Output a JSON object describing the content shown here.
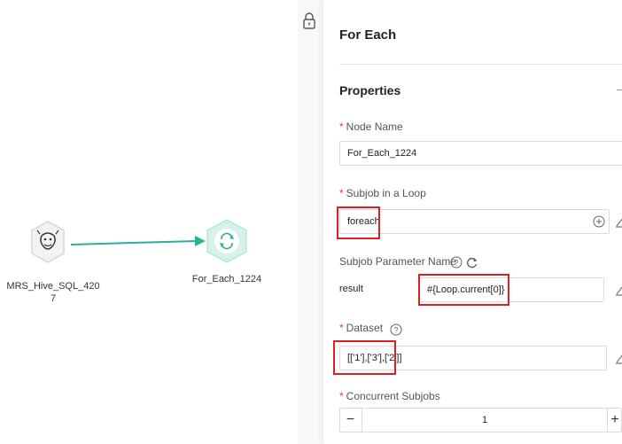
{
  "canvas": {
    "nodes": [
      {
        "name": "MRS_Hive_SQL_4207",
        "label_line1": "MRS_Hive_SQL_420",
        "label_line2": "7",
        "icon": "hive-icon"
      },
      {
        "name": "For_Each_1224",
        "label_line1": "For_Each_1224",
        "icon": "loop-icon"
      }
    ],
    "connector_color": "#2bb09a",
    "lock_icon": "lock-icon"
  },
  "panel": {
    "title": "For Each",
    "section_title": "Properties",
    "node_name": {
      "required": "*",
      "label": "Node Name",
      "value": "For_Each_1224"
    },
    "subjob": {
      "required": "*",
      "label": "Subjob in a Loop",
      "value": "foreach",
      "add_icon": "plus-circle-icon",
      "edit_icon": "edit-icon"
    },
    "subjob_param": {
      "label": "Subjob Parameter Name",
      "help_icon": "help-icon",
      "refresh_icon": "refresh-icon",
      "param_name": "result",
      "param_value": "#{Loop.current[0]}",
      "edit_icon": "edit-icon"
    },
    "dataset": {
      "required": "*",
      "label": "Dataset",
      "help_icon": "help-icon",
      "value": "[['1'],['3'],['2']]",
      "edit_icon": "edit-icon"
    },
    "concurrent": {
      "required": "*",
      "label": "Concurrent Subjobs",
      "minus": "−",
      "value": "1",
      "plus": "+"
    }
  },
  "colors": {
    "accent": "#2bb09a",
    "required": "#e8392b",
    "highlight_box": "#e02020"
  }
}
